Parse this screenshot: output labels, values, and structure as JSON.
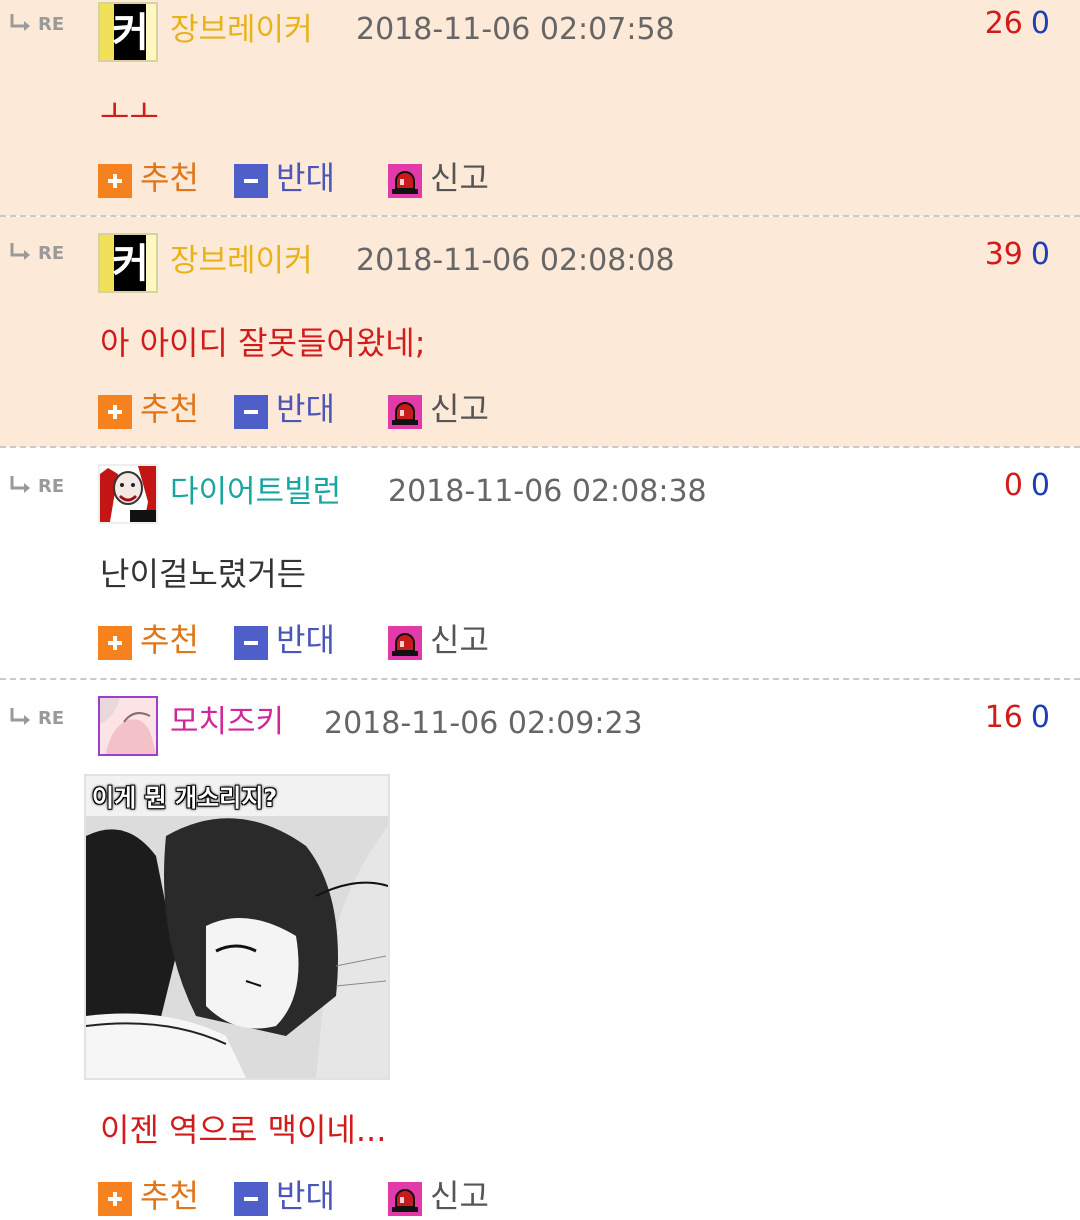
{
  "reply_marker": "RE",
  "colors": {
    "highlight_bg": "#fde9d8",
    "recommend": "#f5821f",
    "oppose": "#4f5fc9",
    "report": "#e23aa9",
    "upvote": "#d21b1b",
    "downvote": "#1c3fb8"
  },
  "comments": [
    {
      "nickname": "장브레이커",
      "nickname_color": "#e8b21a",
      "avatar_text": "커",
      "datetime": "2018-11-06 02:07:58",
      "upvotes": "26",
      "downvotes": "0",
      "text": "ㅗㅗ",
      "text_color": "#d21b1b",
      "highlighted": true,
      "actions": {
        "recommend": "추천",
        "oppose": "반대",
        "report": "신고"
      }
    },
    {
      "nickname": "장브레이커",
      "nickname_color": "#e8b21a",
      "avatar_text": "커",
      "datetime": "2018-11-06 02:08:08",
      "upvotes": "39",
      "downvotes": "0",
      "text": "아 아이디 잘못들어왔네;",
      "text_color": "#d21b1b",
      "highlighted": true,
      "actions": {
        "recommend": "추천",
        "oppose": "반대",
        "report": "신고"
      }
    },
    {
      "nickname": "다이어트빌런",
      "nickname_color": "#1aa6a0",
      "datetime": "2018-11-06 02:08:38",
      "upvotes": "0",
      "downvotes": "0",
      "text": "난이걸노렸거든",
      "text_color": "#333333",
      "highlighted": false,
      "actions": {
        "recommend": "추천",
        "oppose": "반대",
        "report": "신고"
      }
    },
    {
      "nickname": "모치즈키",
      "nickname_color": "#d0289a",
      "datetime": "2018-11-06 02:09:23",
      "upvotes": "16",
      "downvotes": "0",
      "attachment_caption": "이게 뭔 개소리지?",
      "text": "이젠 역으로 맥이네...",
      "text_color": "#d21b1b",
      "highlighted": false,
      "actions": {
        "recommend": "추천",
        "oppose": "반대",
        "report": "신고"
      }
    }
  ]
}
